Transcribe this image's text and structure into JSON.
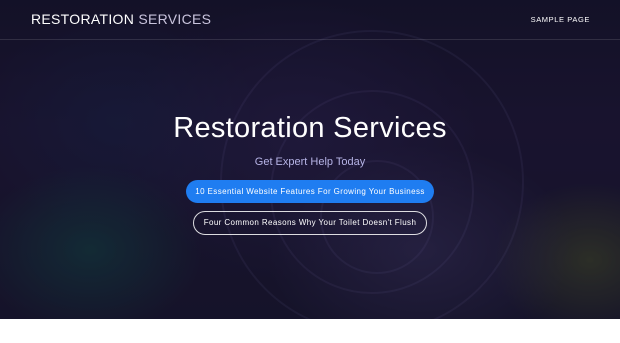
{
  "header": {
    "logo_bold": "RESTORATION",
    "logo_light": "SERVICES",
    "nav": [
      {
        "label": "SAMPLE PAGE"
      }
    ]
  },
  "hero": {
    "title": "Restoration Services",
    "subtitle": "Get Expert Help Today",
    "buttons": [
      {
        "label": "10 Essential Website Features For Growing Your Business",
        "style": "primary"
      },
      {
        "label": "Four Common Reasons Why Your Toilet Doesn't Flush",
        "style": "outline"
      }
    ]
  },
  "colors": {
    "primary_button": "#1f7df1",
    "subtitle": "#b6b4e6",
    "footer_strip": "#ffffff"
  }
}
